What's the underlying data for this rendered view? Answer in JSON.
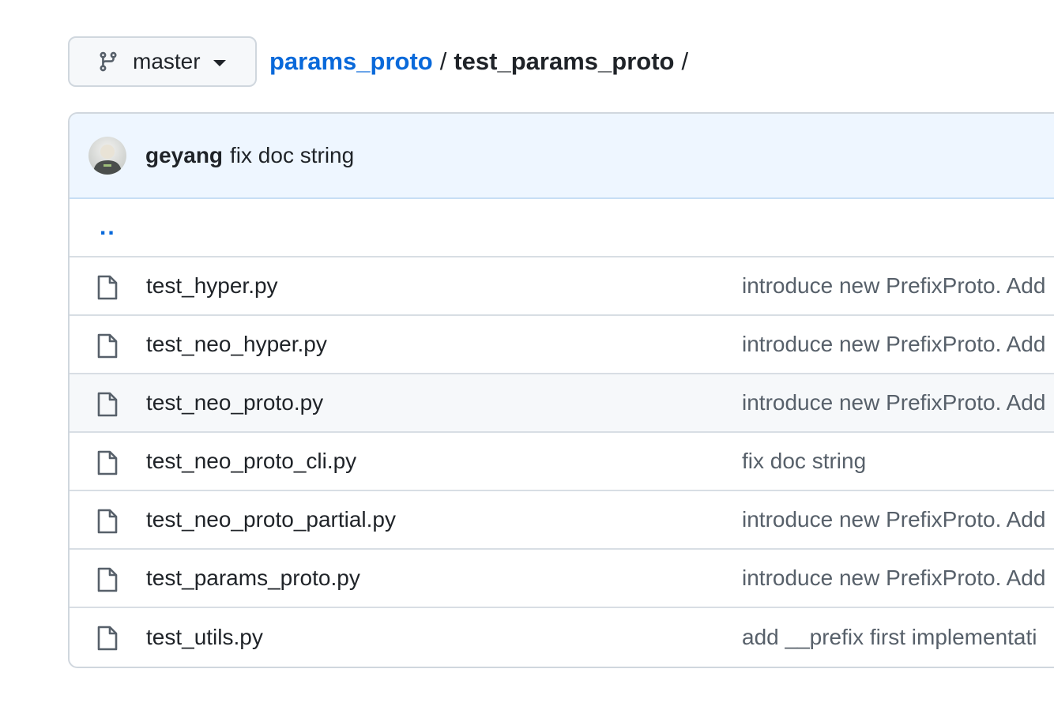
{
  "branch": {
    "label": "master",
    "icon": "git-branch-icon"
  },
  "breadcrumb": {
    "repo": "params_proto",
    "separator": "/",
    "directory": "test_params_proto",
    "trailing": "/"
  },
  "latest_commit": {
    "author": "geyang",
    "message": "fix doc string"
  },
  "parent_dir": {
    "label": ".."
  },
  "files": [
    {
      "name": "test_hyper.py",
      "commit": "introduce new PrefixProto. Add"
    },
    {
      "name": "test_neo_hyper.py",
      "commit": "introduce new PrefixProto. Add"
    },
    {
      "name": "test_neo_proto.py",
      "commit": "introduce new PrefixProto. Add"
    },
    {
      "name": "test_neo_proto_cli.py",
      "commit": "fix doc string"
    },
    {
      "name": "test_neo_proto_partial.py",
      "commit": "introduce new PrefixProto. Add"
    },
    {
      "name": "test_params_proto.py",
      "commit": "introduce new PrefixProto. Add"
    },
    {
      "name": "test_utils.py",
      "commit": "add __prefix first implementati"
    }
  ],
  "colors": {
    "link": "#0969da",
    "header_bg": "#eef6ff",
    "border": "#d0d7de",
    "muted_text": "#57606a"
  }
}
